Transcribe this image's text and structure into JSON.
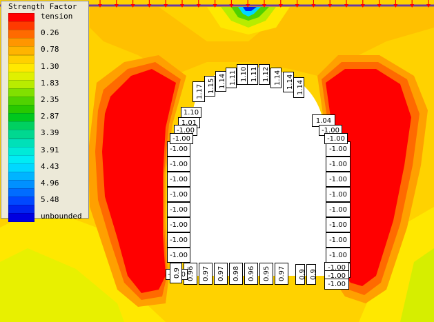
{
  "legend": {
    "title": "Strength Factor",
    "entries": [
      {
        "label": "tension",
        "color": "#ff0000"
      },
      {
        "label": "",
        "color": "#ff3a00"
      },
      {
        "label": "0.26",
        "color": "#ff6a00"
      },
      {
        "label": "",
        "color": "#ff9600"
      },
      {
        "label": "0.78",
        "color": "#ffb400"
      },
      {
        "label": "",
        "color": "#ffd000"
      },
      {
        "label": "1.30",
        "color": "#ffe800"
      },
      {
        "label": "",
        "color": "#e0f000"
      },
      {
        "label": "1.83",
        "color": "#b8ec00"
      },
      {
        "label": "",
        "color": "#80e000"
      },
      {
        "label": "2.35",
        "color": "#50d200"
      },
      {
        "label": "",
        "color": "#28c800"
      },
      {
        "label": "2.87",
        "color": "#00c81e"
      },
      {
        "label": "",
        "color": "#00d060"
      },
      {
        "label": "3.39",
        "color": "#00d890"
      },
      {
        "label": "",
        "color": "#00e0b8"
      },
      {
        "label": "3.91",
        "color": "#00ead8"
      },
      {
        "label": "",
        "color": "#00ecf4"
      },
      {
        "label": "4.43",
        "color": "#00d8ff"
      },
      {
        "label": "",
        "color": "#00b4ff"
      },
      {
        "label": "4.96",
        "color": "#0090ff"
      },
      {
        "label": "",
        "color": "#006cff"
      },
      {
        "label": "5.48",
        "color": "#0048ff"
      },
      {
        "label": "",
        "color": "#0024f0"
      },
      {
        "label": "unbounded",
        "color": "#0000e0"
      }
    ]
  },
  "tunnel": {
    "left_wall": [
      "-1.00",
      "-1.00",
      "-1.00",
      "-1.00",
      "-1.00",
      "-1.00",
      "-1.00",
      "-1.00"
    ],
    "right_wall": [
      "-1.00",
      "-1.00",
      "-1.00",
      "-1.00",
      "-1.00",
      "-1.00",
      "-1.00",
      "-1.00",
      "-1.00"
    ],
    "left_shoulder": [
      "1.10",
      "1.01",
      "-1.00",
      "-1.00"
    ],
    "right_shoulder": [
      "1.04",
      "-1.00",
      "-1.00"
    ],
    "crown": [
      "1.17",
      "1.15",
      "1.14",
      "1.11",
      "1.10",
      "1.11",
      "1.12",
      "1.14",
      "1.14",
      "1.14"
    ],
    "floor": [
      "0.96",
      "0.97",
      "0.97",
      "0.98",
      "0.96",
      "0.95",
      "0.97"
    ],
    "floor_corner_left": [
      "-1.00",
      "0.9"
    ],
    "floor_corner_right": [
      "0.9",
      "0.9",
      "-1.00",
      "-1.00",
      "-1.00"
    ]
  },
  "loads": {
    "count": 21,
    "color": "#ff0000"
  }
}
